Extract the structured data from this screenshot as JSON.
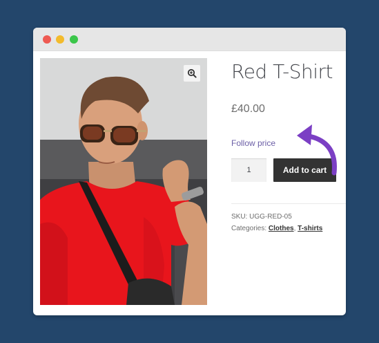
{
  "window": {
    "controls": [
      "close",
      "minimize",
      "maximize"
    ]
  },
  "product": {
    "image_alt": "Man wearing a red t-shirt and aviator sunglasses",
    "zoom_icon": "magnifier-plus-icon",
    "title": "Red T-Shirt",
    "price": "£40.00",
    "follow_link": "Follow price",
    "quantity": "1",
    "add_to_cart_label": "Add to cart",
    "sku_label": "SKU:",
    "sku_value": "UGG-RED-05",
    "categories_label": "Categories:",
    "categories": [
      "Clothes",
      "T-shirts"
    ],
    "categories_separator": ", "
  },
  "colors": {
    "background": "#23466b",
    "accent_arrow": "#7b3fc4",
    "link": "#6b5ea6",
    "button": "#333333"
  }
}
